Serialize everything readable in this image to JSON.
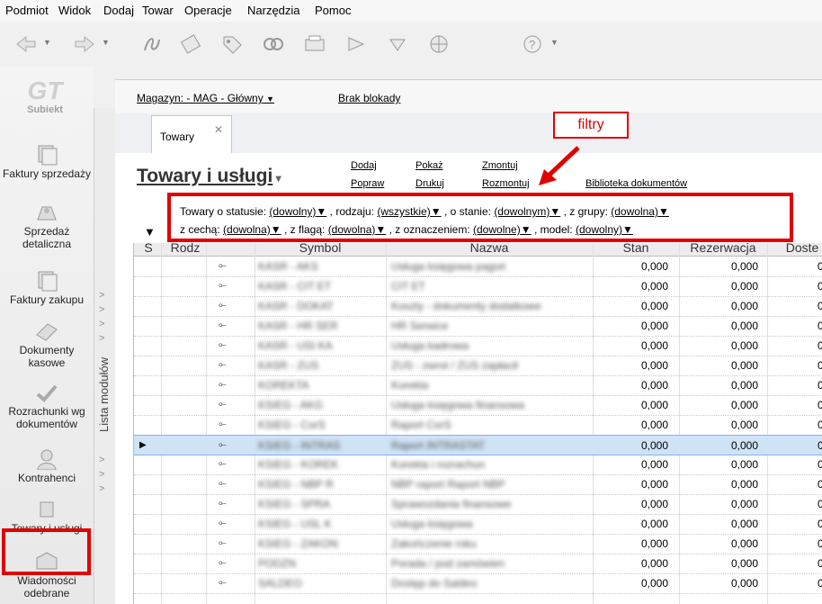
{
  "menu": [
    "Podmiot",
    "Widok",
    "Dodaj",
    "Towar",
    "Operacje",
    "Narzędzia",
    "Pomoc"
  ],
  "toolbar_icons": [
    "back-icon",
    "forward-icon",
    "sign-icon",
    "eraser-icon",
    "tag-icon",
    "link-icon",
    "scanner-icon",
    "play-icon",
    "arrow-down-icon",
    "globe-icon",
    "help-icon"
  ],
  "sidebar": {
    "logo": "Subiekt",
    "module_list_label": "Lista modułów",
    "items": [
      {
        "label": "Faktury sprzedaży",
        "icon": "invoice-icon"
      },
      {
        "label": "Sprzedaż detaliczna",
        "icon": "retail-icon"
      },
      {
        "label": "Faktury zakupu",
        "icon": "purchase-icon"
      },
      {
        "label": "Dokumenty kasowe",
        "icon": "cash-icon"
      },
      {
        "label": "Rozrachunki wg dokumentów",
        "icon": "settlement-icon"
      },
      {
        "label": "Kontrahenci",
        "icon": "contractors-icon"
      },
      {
        "label": "Towary i usługi",
        "icon": "goods-icon"
      },
      {
        "label": "Wiadomości odebrane",
        "icon": "messages-icon"
      }
    ]
  },
  "header": {
    "warehouse": "Magazyn: - MAG - Główny",
    "lock": "Brak blokady",
    "tab": "Towary",
    "title": "Towary i usługi",
    "actions": [
      "Dodaj",
      "Popraw",
      "Pokaż",
      "Drukuj",
      "Zmontuj",
      "Rozmontuj"
    ],
    "library": "Biblioteka dokumentów",
    "callout": "filtry"
  },
  "filters": {
    "status_label": "Towary o statusie:",
    "status": "(dowolny)",
    "type_label": ", rodzaju:",
    "type": "(wszystkie)",
    "stock_label": ", o stanie:",
    "stock": "(dowolnym)",
    "group_label": ", z grupy:",
    "group": "(dowolna)",
    "feature_label": "z cechą:",
    "feature": "(dowolna)",
    "flag_label": ", z flagą:",
    "flag": "(dowolna)",
    "mark_label": ", z oznaczeniem:",
    "mark": "(dowolne)",
    "model_label": ", model:",
    "model": "(dowolny)"
  },
  "table": {
    "columns": [
      "S",
      "Rodz",
      "Symbol",
      "Nazwa",
      "Stan",
      "Rezerwacja",
      "Doste"
    ],
    "rows": [
      {
        "symbol": "KASR - AKS",
        "name": "Usługa księgowa pagoń",
        "stan": "0,000",
        "rez": "0,000",
        "dost": "0"
      },
      {
        "symbol": "KASR - CIT ET",
        "name": "CIT ET",
        "stan": "0,000",
        "rez": "0,000",
        "dost": "0"
      },
      {
        "symbol": "KASR - DOKAT",
        "name": "Koszty - dokumenty dodatkowe",
        "stan": "0,000",
        "rez": "0,000",
        "dost": "0"
      },
      {
        "symbol": "KASR - HR SER",
        "name": "HR Serwice",
        "stan": "0,000",
        "rez": "0,000",
        "dost": "0"
      },
      {
        "symbol": "KASR - USI KA",
        "name": "Usługa kadrowa",
        "stan": "0,000",
        "rez": "0,000",
        "dost": "0"
      },
      {
        "symbol": "KASR - ZUS",
        "name": "ZUS - zwrot / ZUS zapłacił",
        "stan": "0,000",
        "rez": "0,000",
        "dost": "0"
      },
      {
        "symbol": "KOREKTA",
        "name": "Korekta",
        "stan": "0,000",
        "rez": "0,000",
        "dost": "0"
      },
      {
        "symbol": "KSIEG - AKG",
        "name": "Usługa księgowa finansowa",
        "stan": "0,000",
        "rez": "0,000",
        "dost": "0"
      },
      {
        "symbol": "KSIEG - CorS",
        "name": "Raport CorS",
        "stan": "0,000",
        "rez": "0,000",
        "dost": "0"
      },
      {
        "symbol": "KSIEG - INTRAS",
        "name": "Raport INTRASTAT",
        "stan": "0,000",
        "rez": "0,000",
        "dost": "0",
        "selected": true
      },
      {
        "symbol": "KSIEG - KOREK",
        "name": "Korekta i rozrachun",
        "stan": "0,000",
        "rez": "0,000",
        "dost": "0"
      },
      {
        "symbol": "KSIEG - NBP R",
        "name": "NBP raport Raport NBP",
        "stan": "0,000",
        "rez": "0,000",
        "dost": "0"
      },
      {
        "symbol": "KSIEG - SPRA",
        "name": "Sprawozdania finansowe",
        "stan": "0,000",
        "rez": "0,000",
        "dost": "0"
      },
      {
        "symbol": "KSIEG - USL K",
        "name": "Usługa księgowa",
        "stan": "0,000",
        "rez": "0,000",
        "dost": "0"
      },
      {
        "symbol": "KSIEG - ZAKON",
        "name": "Zakończenie roku",
        "stan": "0,000",
        "rez": "0,000",
        "dost": "0"
      },
      {
        "symbol": "PODZN",
        "name": "Porada / pod zamówien",
        "stan": "0,000",
        "rez": "0,000",
        "dost": "0"
      },
      {
        "symbol": "SALDEO",
        "name": "Dostęp do Saldeo",
        "stan": "0,000",
        "rez": "0,000",
        "dost": "0"
      }
    ]
  },
  "colors": {
    "highlight_red": "#e00000",
    "selected_row": "#cfe3f7"
  }
}
